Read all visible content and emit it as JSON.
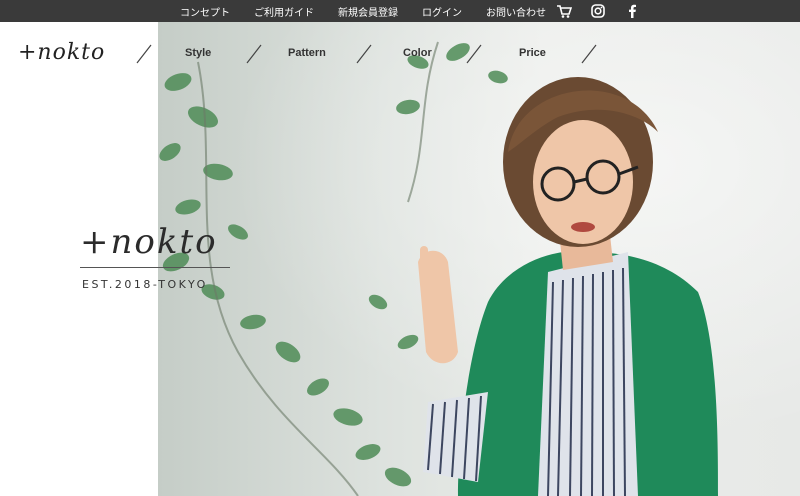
{
  "topbar": {
    "links": [
      {
        "label": "コンセプト"
      },
      {
        "label": "ご利用ガイド"
      },
      {
        "label": "新規会員登録"
      },
      {
        "label": "ログイン"
      },
      {
        "label": "お問い合わせ"
      }
    ],
    "icons": [
      "cart-icon",
      "instagram-icon",
      "facebook-icon"
    ]
  },
  "brand": {
    "logo_text": "+nokto"
  },
  "nav": {
    "items": [
      {
        "label": "Style"
      },
      {
        "label": "Pattern"
      },
      {
        "label": "Color"
      },
      {
        "label": "Price"
      }
    ]
  },
  "hero": {
    "logo_text": "+nokto",
    "tagline": "EST.2018-TOKYO"
  },
  "colors": {
    "topbar_bg": "#3a3a3a",
    "cardigan": "#1f8a5a",
    "text": "#333333"
  }
}
